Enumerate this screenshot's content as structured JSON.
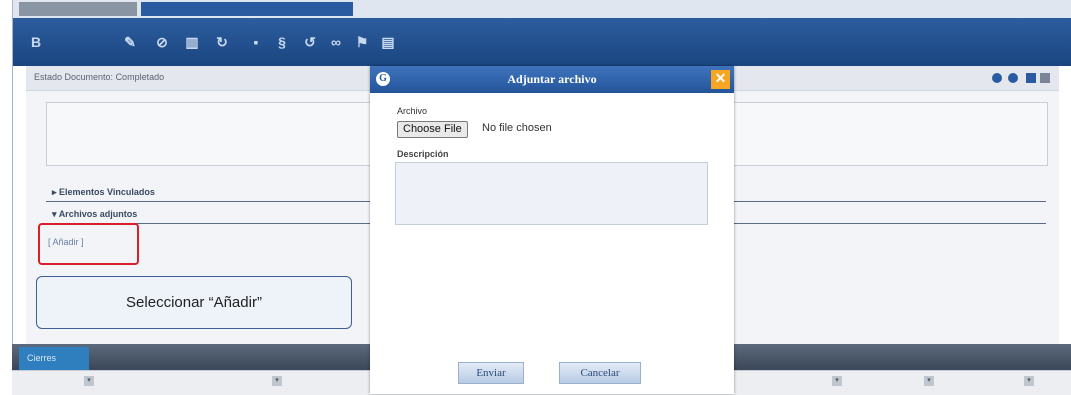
{
  "toolbar": {
    "icons": [
      "bold-icon",
      "edit-icon",
      "block-icon",
      "trash-icon",
      "refresh-icon",
      "lock-icon",
      "link-icon",
      "rotate-icon",
      "chain-icon",
      "flag-icon",
      "grid-icon"
    ]
  },
  "panel": {
    "estado_label": "Estado Documento:",
    "estado_value": "Completado",
    "sections": [
      {
        "label": "Elementos Vinculados",
        "expanded": false
      },
      {
        "label": "Archivos adjuntos",
        "expanded": true
      }
    ],
    "add_link": "[ Añadir ]"
  },
  "callout": {
    "text": "Seleccionar “Añadir”"
  },
  "bottom": {
    "tab_label": "Cierres"
  },
  "dialog": {
    "title": "Adjuntar archivo",
    "archivo_label": "Archivo",
    "choose_button": "Choose File",
    "no_file": "No file chosen",
    "descripcion_label": "Descripción",
    "descripcion_value": "",
    "submit": "Enviar",
    "cancel": "Cancelar"
  },
  "colors": {
    "title_bar": "#2d5d9e",
    "highlight": "#d9202a",
    "close": "#f6a623"
  }
}
